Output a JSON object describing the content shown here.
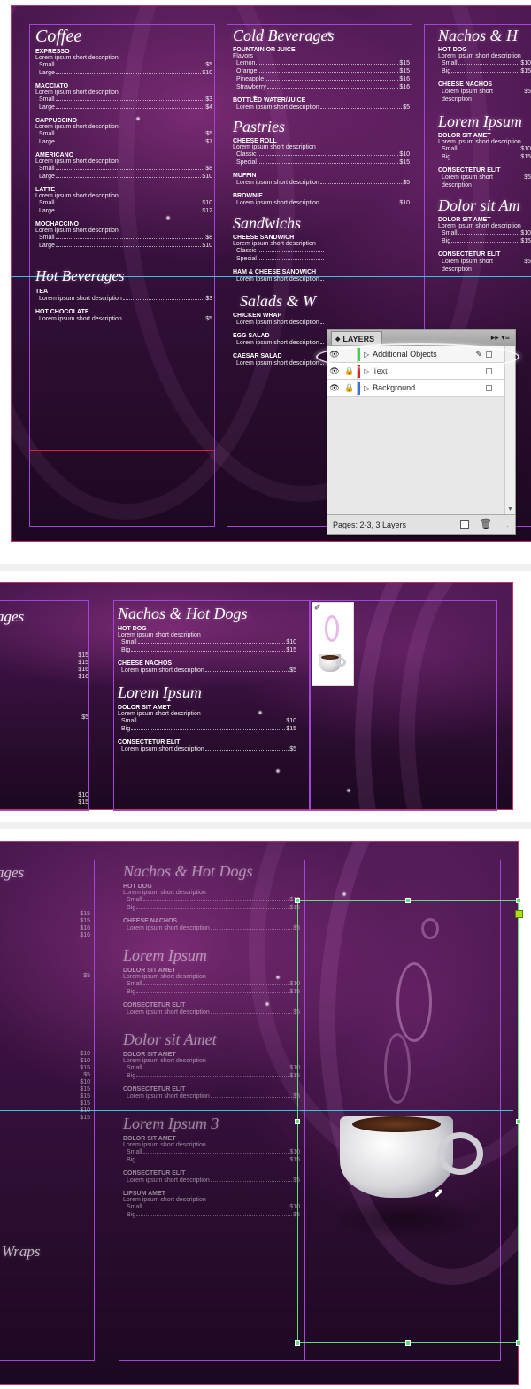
{
  "colors": {
    "accent_magenta": "#a246d8",
    "guide_cyan": "#30c8e0",
    "frame_green": "#5ee07a",
    "page_border": "#c0306a"
  },
  "menu": {
    "coffee": {
      "title": "Coffee",
      "items": [
        {
          "name": "EXPRESSO",
          "desc": "Lorem ipsum short description",
          "prices": [
            {
              "label": "Small",
              "price": "$5"
            },
            {
              "label": "Large",
              "price": "$10"
            }
          ]
        },
        {
          "name": "MACCIATO",
          "desc": "Lorem ipsum short description",
          "prices": [
            {
              "label": "Small",
              "price": "$3"
            },
            {
              "label": "Large",
              "price": "$4"
            }
          ]
        },
        {
          "name": "CAPPUCCINO",
          "desc": "Lorem ipsum short description",
          "prices": [
            {
              "label": "Small",
              "price": "$5"
            },
            {
              "label": "Large",
              "price": "$7"
            }
          ]
        },
        {
          "name": "AMERICANO",
          "desc": "Lorem ipsum short description",
          "prices": [
            {
              "label": "Small",
              "price": "$8"
            },
            {
              "label": "Large",
              "price": "$10"
            }
          ]
        },
        {
          "name": "LATTE",
          "desc": "Lorem ipsum short description",
          "prices": [
            {
              "label": "Small",
              "price": "$10"
            },
            {
              "label": "Large",
              "price": "$12"
            }
          ]
        },
        {
          "name": "MOCHACCINO",
          "desc": "Lorem ipsum short description",
          "prices": [
            {
              "label": "Small",
              "price": "$8"
            },
            {
              "label": "Large",
              "price": "$10"
            }
          ]
        }
      ]
    },
    "hot_beverages": {
      "title": "Hot Beverages",
      "items": [
        {
          "name": "TEA",
          "desc": "",
          "prices": [
            {
              "label": "Lorem ipsum short description",
              "price": "$3"
            }
          ]
        },
        {
          "name": "HOT CHOCOLATE",
          "desc": "",
          "prices": [
            {
              "label": "Lorem ipsum short description",
              "price": "$5"
            }
          ]
        }
      ]
    },
    "cold_beverages": {
      "title": "Cold Beverages",
      "items": [
        {
          "name": "FOUNTAIN OR JUICE",
          "desc": "Flavors",
          "prices": [
            {
              "label": "Lemon",
              "price": "$15"
            },
            {
              "label": "Orange",
              "price": "$15"
            },
            {
              "label": "Pineapple",
              "price": "$16"
            },
            {
              "label": "Strawberry",
              "price": "$16"
            }
          ]
        },
        {
          "name": "BOTTLED WATER/JUICE",
          "desc": "",
          "prices": [
            {
              "label": "Lorem ipsum short description",
              "price": "$5"
            }
          ]
        }
      ]
    },
    "pastries": {
      "title": "Pastries",
      "items": [
        {
          "name": "CHEESE ROLL",
          "desc": "Lorem ipsum short description",
          "prices": [
            {
              "label": "Classic",
              "price": "$10"
            },
            {
              "label": "Special",
              "price": "$15"
            }
          ]
        },
        {
          "name": "MUFFIN",
          "desc": "",
          "prices": [
            {
              "label": "Lorem ipsum short description",
              "price": "$5"
            }
          ]
        },
        {
          "name": "BROWNIE",
          "desc": "",
          "prices": [
            {
              "label": "Lorem ipsum short description",
              "price": "$10"
            }
          ]
        }
      ]
    },
    "sandwiches": {
      "title": "Sandwichs",
      "items": [
        {
          "name": "CHEESE SANDWICH",
          "desc": "Lorem ipsum short description",
          "prices": [
            {
              "label": "Classic",
              "price": ""
            },
            {
              "label": "Special",
              "price": ""
            }
          ]
        },
        {
          "name": "HAM & CHEESE SANDWICH",
          "desc": "",
          "prices": [
            {
              "label": "Lorem ipsum short description",
              "price": ""
            }
          ]
        }
      ]
    },
    "salads": {
      "title": "Salads & W",
      "items": [
        {
          "name": "CHICKEN WRAP",
          "desc": "",
          "prices": [
            {
              "label": "Lorem ipsum short description",
              "price": ""
            }
          ]
        },
        {
          "name": "EGG SALAD",
          "desc": "",
          "prices": [
            {
              "label": "Lorem ipsum short description",
              "price": ""
            }
          ]
        },
        {
          "name": "CAESAR SALAD",
          "desc": "",
          "prices": [
            {
              "label": "Lorem ipsum short description",
              "price": ""
            }
          ]
        }
      ]
    },
    "nachos": {
      "title": "Nachos & Hot Dogs",
      "title_cut": "Nachos & H",
      "items": [
        {
          "name": "HOT DOG",
          "desc": "Lorem ipsum short description",
          "prices": [
            {
              "label": "Small",
              "price": "$10"
            },
            {
              "label": "Big",
              "price": "$15"
            }
          ]
        },
        {
          "name": "CHEESE NACHOS",
          "desc": "",
          "prices": [
            {
              "label": "Lorem ipsum short description",
              "price": "$5"
            }
          ]
        }
      ]
    },
    "lorem1": {
      "title": "Lorem Ipsum",
      "title_cut": "Lorem Ipsum",
      "items": [
        {
          "name": "DOLOR SIT AMET",
          "desc": "Lorem ipsum short description",
          "prices": [
            {
              "label": "Small",
              "price": "$10"
            },
            {
              "label": "Big",
              "price": "$15"
            }
          ]
        },
        {
          "name": "CONSECTETUR ELIT",
          "desc": "",
          "prices": [
            {
              "label": "Lorem ipsum short description",
              "price": "$5"
            }
          ]
        }
      ]
    },
    "dolor": {
      "title": "Dolor sit Amet",
      "title_cut": "Dolor sit Am",
      "items": [
        {
          "name": "DOLOR SIT AMET",
          "desc": "Lorem ipsum short description",
          "prices": [
            {
              "label": "Small",
              "price": "$10"
            },
            {
              "label": "Big",
              "price": "$15"
            }
          ]
        },
        {
          "name": "CONSECTETUR ELIT",
          "desc": "",
          "prices": [
            {
              "label": "Lorem ipsum short description",
              "price": "$5"
            }
          ]
        }
      ]
    },
    "lorem3": {
      "title": "Lorem Ipsum 3",
      "items": [
        {
          "name": "DOLOR SIT AMET",
          "desc": "Lorem ipsum short description",
          "prices": [
            {
              "label": "Small",
              "price": "$10"
            },
            {
              "label": "Big",
              "price": "$15"
            }
          ]
        },
        {
          "name": "CONSECTETUR ELIT",
          "desc": "",
          "prices": [
            {
              "label": "Lorem ipsum short description",
              "price": "$5"
            }
          ]
        },
        {
          "name": "LIPSUM AMET",
          "desc": "Lorem ipsum short description",
          "prices": [
            {
              "label": "Small",
              "price": "$10"
            },
            {
              "label": "Big",
              "price": "$5"
            }
          ]
        }
      ]
    },
    "partial_title_ages": "ages",
    "partial_title_wraps": "Wraps",
    "partial_prices_a": [
      "$15",
      "$15",
      "$16",
      "$16",
      "$5",
      "$10",
      "$15"
    ],
    "partial_prices_c": [
      "$15",
      "$15",
      "$16",
      "$16",
      "$5",
      "$10",
      "$10",
      "$15",
      "$5",
      "$10",
      "$15",
      "$15",
      "$15",
      "$10",
      "$15"
    ]
  },
  "layers_panel": {
    "tab_label": "LAYERS",
    "layers": [
      {
        "name": "Additional Objects",
        "color": "#3fd64a"
      },
      {
        "name": "Text",
        "color": "#e02020"
      },
      {
        "name": "Background",
        "color": "#3a6fe0"
      }
    ],
    "footer": "Pages: 2-3, 3 Layers"
  }
}
